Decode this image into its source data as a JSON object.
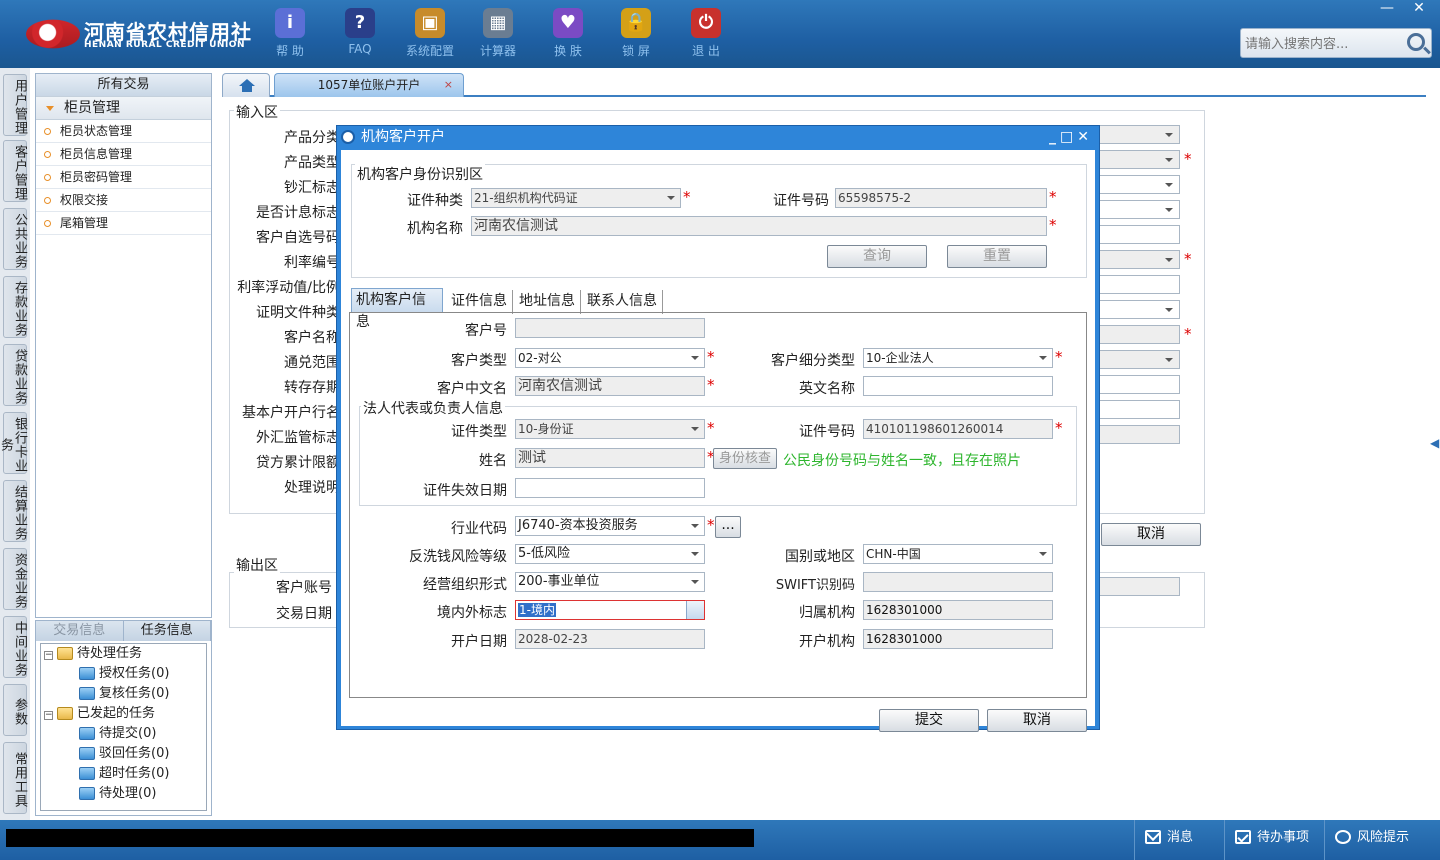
{
  "app": {
    "brand_cn": "河南省农村信用社",
    "brand_en": "HENAN RURAL CREDIT UNION",
    "search_placeholder": "请输入搜索内容...",
    "toolbar": [
      {
        "label": "帮 助",
        "icon": "info-icon",
        "color": "#5b6fd6",
        "glyph": "i"
      },
      {
        "label": "FAQ",
        "icon": "question-icon",
        "color": "#2a3f8a",
        "glyph": "?"
      },
      {
        "label": "系统配置",
        "icon": "toolbox-icon",
        "color": "#c78b2a",
        "glyph": "▣"
      },
      {
        "label": "计算器",
        "icon": "calculator-icon",
        "color": "#6a7d92",
        "glyph": "▦"
      },
      {
        "label": "换 肤",
        "icon": "shirt-icon",
        "color": "#7b4bc4",
        "glyph": "♥"
      },
      {
        "label": "锁 屏",
        "icon": "lock-icon",
        "color": "#d4a017",
        "glyph": "🔒"
      },
      {
        "label": "退 出",
        "icon": "power-icon",
        "color": "#c8312c",
        "glyph": "⏻"
      }
    ]
  },
  "leftnav": [
    "用户管理",
    "客户管理",
    "公共业务",
    "存款业务",
    "贷款业务",
    "银行卡业务",
    "结算业务",
    "资金业务",
    "中间业务",
    "参数",
    "常用工具"
  ],
  "menu": {
    "header": "所有交易",
    "group": "柜员管理",
    "items": [
      "柜员状态管理",
      "柜员信息管理",
      "柜员密码管理",
      "权限交接",
      "尾箱管理"
    ]
  },
  "tasks": {
    "tab1": "交易信息",
    "tab2": "任务信息",
    "pending": "待处理任务",
    "auth": "授权任务(0)",
    "review": "复核任务(0)",
    "initiated": "已发起的任务",
    "submit": "待提交(0)",
    "rejected": "驳回任务(0)",
    "timeout": "超时任务(0)",
    "todo": "待处理(0)"
  },
  "tabs": {
    "active": "1057单位账户开户",
    "close": "×"
  },
  "bgform": {
    "input_area": "输入区",
    "output_area": "输出区",
    "labels": [
      "产品分类",
      "产品类型",
      "钞汇标志",
      "是否计息标志",
      "客户自选号码",
      "利率编号",
      "利率浮动值/比例",
      "证明文件种类",
      "客户名称",
      "通兑范围",
      "转存存期",
      "基本户开户行名",
      "外汇监管标志",
      "贷方累计限额",
      "处理说明"
    ],
    "out_labels": [
      "客户账号",
      "交易日期"
    ],
    "cancel": "取消"
  },
  "dialog": {
    "title": "机构客户开户",
    "id_section": "机构客户身份识别区",
    "cert_type_label": "证件种类",
    "cert_type": "21-组织机构代码证",
    "cert_no_label": "证件号码",
    "cert_no": "65598575-2",
    "org_name_label": "机构名称",
    "org_name": "河南农信测试",
    "query": "查询",
    "reset": "重置",
    "tabs": [
      "机构客户信息",
      "证件信息",
      "地址信息",
      "联系人信息"
    ],
    "cust_no_label": "客户号",
    "cust_no": "",
    "cust_type_label": "客户类型",
    "cust_type": "02-对公",
    "cust_sub_label": "客户细分类型",
    "cust_sub": "10-企业法人",
    "cn_name_label": "客户中文名",
    "cn_name": "河南农信测试",
    "en_name_label": "英文名称",
    "en_name": "",
    "legal_section": "法人代表或负责人信息",
    "legal_cert_type_label": "证件类型",
    "legal_cert_type": "10-身份证",
    "legal_cert_no_label": "证件号码",
    "legal_cert_no": "410101198601260014",
    "legal_name_label": "姓名",
    "legal_name": "测试",
    "verify": "身份核查",
    "verify_msg": "公民身份号码与姓名一致，且存在照片",
    "expire_label": "证件失效日期",
    "expire": "",
    "industry_label": "行业代码",
    "industry": "J6740-资本投资服务",
    "more": "...",
    "aml_label": "反洗钱风险等级",
    "aml": "5-低风险",
    "country_label": "国别或地区",
    "country": "CHN-中国",
    "org_form_label": "经营组织形式",
    "org_form": "200-事业单位",
    "swift_label": "SWIFT识别码",
    "swift": "",
    "domestic_label": "境内外标志",
    "domestic": "1-境内",
    "branch_label": "归属机构",
    "branch": "1628301000",
    "open_date_label": "开户日期",
    "open_date": "2028-02-23",
    "open_branch_label": "开户机构",
    "open_branch": "1628301000",
    "submit": "提交",
    "cancel": "取消"
  },
  "status": {
    "msg": "消息",
    "todo": "待办事项",
    "risk": "风险提示"
  }
}
